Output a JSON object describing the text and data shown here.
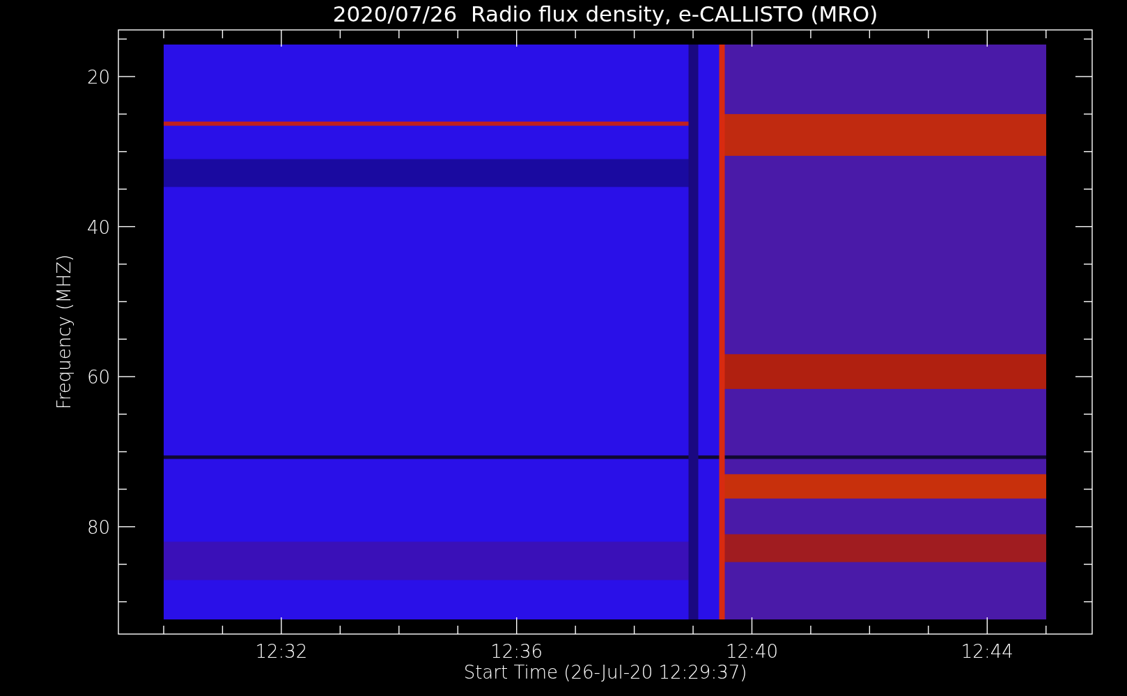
{
  "plot": {
    "title": "2020/07/26  Radio flux density, e-CALLISTO (MRO)",
    "ylabel": "Frequency (MHZ)",
    "xlabel": "Start Time (26-Jul-20 12:29:37)",
    "yticks": [
      "20",
      "40",
      "60",
      "80"
    ],
    "xticks": [
      "12:32",
      "12:36",
      "12:40",
      "12:44"
    ]
  }
}
